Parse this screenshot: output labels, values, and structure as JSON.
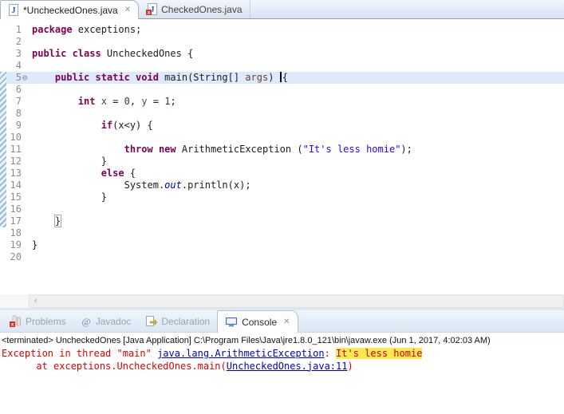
{
  "icons": {
    "fold": "⊖",
    "close": "✕",
    "scroll_left": "‹"
  },
  "colors": {
    "keyword": "#7f0055",
    "string": "#2a00ff",
    "static_field": "#0000c0",
    "local_var": "#6a3e3e",
    "stderr": "#dd0000",
    "hyperlink": "#0000cc",
    "highlight_bg": "#fce94f",
    "current_line_bg": "#ddeafa"
  },
  "editor_tabbar": {
    "tabs": [
      {
        "label": "*UncheckedOnes.java",
        "icon": "java-file",
        "active": true,
        "closable": true
      },
      {
        "label": "CheckedOnes.java",
        "icon": "java-file-error",
        "active": false,
        "closable": false
      }
    ]
  },
  "editor": {
    "current_line": 5,
    "range_lines": {
      "from": 5,
      "to": 17
    },
    "fold_line": 5,
    "line_count": 20,
    "lines": [
      [
        {
          "t": "package",
          "c": "kw"
        },
        {
          "t": " exceptions;",
          "c": "pl"
        }
      ],
      [],
      [
        {
          "t": "public class",
          "c": "kw"
        },
        {
          "t": " UncheckedOnes {",
          "c": "pl"
        }
      ],
      [],
      [
        {
          "t": "    ",
          "c": "pl"
        },
        {
          "t": "public static void",
          "c": "kw"
        },
        {
          "t": " main(String[] ",
          "c": "pl"
        },
        {
          "t": "args",
          "c": "vd"
        },
        {
          "t": ") ",
          "c": "pl"
        },
        {
          "t": "",
          "c": "caret"
        },
        {
          "t": "{",
          "c": "pl"
        }
      ],
      [],
      [
        {
          "t": "        ",
          "c": "pl"
        },
        {
          "t": "int",
          "c": "kw"
        },
        {
          "t": " ",
          "c": "pl"
        },
        {
          "t": "x",
          "c": "vd"
        },
        {
          "t": " = ",
          "c": "pl"
        },
        {
          "t": "0",
          "c": "num"
        },
        {
          "t": ", ",
          "c": "pl"
        },
        {
          "t": "y",
          "c": "vd"
        },
        {
          "t": " = ",
          "c": "pl"
        },
        {
          "t": "1",
          "c": "num"
        },
        {
          "t": ";",
          "c": "pl"
        }
      ],
      [],
      [
        {
          "t": "            ",
          "c": "pl"
        },
        {
          "t": "if",
          "c": "kw"
        },
        {
          "t": "(x<y) {",
          "c": "pl"
        }
      ],
      [],
      [
        {
          "t": "                ",
          "c": "pl"
        },
        {
          "t": "throw",
          "c": "kw"
        },
        {
          "t": " ",
          "c": "pl"
        },
        {
          "t": "new",
          "c": "kw"
        },
        {
          "t": " ArithmeticException (",
          "c": "pl"
        },
        {
          "t": "\"It's less homie\"",
          "c": "str"
        },
        {
          "t": ");",
          "c": "pl"
        }
      ],
      [
        {
          "t": "            }",
          "c": "pl"
        }
      ],
      [
        {
          "t": "            ",
          "c": "pl"
        },
        {
          "t": "else",
          "c": "kw"
        },
        {
          "t": " {",
          "c": "pl"
        }
      ],
      [
        {
          "t": "                System.",
          "c": "pl"
        },
        {
          "t": "out",
          "c": "sf"
        },
        {
          "t": ".println(x);",
          "c": "pl"
        }
      ],
      [
        {
          "t": "            }",
          "c": "pl"
        }
      ],
      [],
      [
        {
          "t": "    ",
          "c": "pl"
        },
        {
          "t": "}",
          "c": "brace"
        }
      ],
      [],
      [
        {
          "t": "}",
          "c": "pl"
        }
      ],
      []
    ]
  },
  "console_tabbar": {
    "tabs": [
      {
        "label": "Problems",
        "icon": "problems",
        "active": false,
        "closable": false
      },
      {
        "label": "Javadoc",
        "icon": "javadoc",
        "active": false,
        "closable": false
      },
      {
        "label": "Declaration",
        "icon": "declaration",
        "active": false,
        "closable": false
      },
      {
        "label": "Console",
        "icon": "console",
        "active": true,
        "closable": true
      }
    ]
  },
  "console": {
    "header": "<terminated> UncheckedOnes [Java Application] C:\\Program Files\\Java\\jre1.8.0_121\\bin\\javaw.exe (Jun 1, 2017, 4:02:03 AM)",
    "lines": [
      [
        {
          "t": "Exception in thread \"main\" ",
          "c": "err"
        },
        {
          "t": "java.lang.ArithmeticException",
          "c": "link"
        },
        {
          "t": ": ",
          "c": "err"
        },
        {
          "t": "It's less homie",
          "c": "hl"
        }
      ],
      [
        {
          "t": "      at exceptions.UncheckedOnes.main(",
          "c": "err"
        },
        {
          "t": "UncheckedOnes.java:11",
          "c": "link"
        },
        {
          "t": ")",
          "c": "err"
        }
      ]
    ]
  }
}
